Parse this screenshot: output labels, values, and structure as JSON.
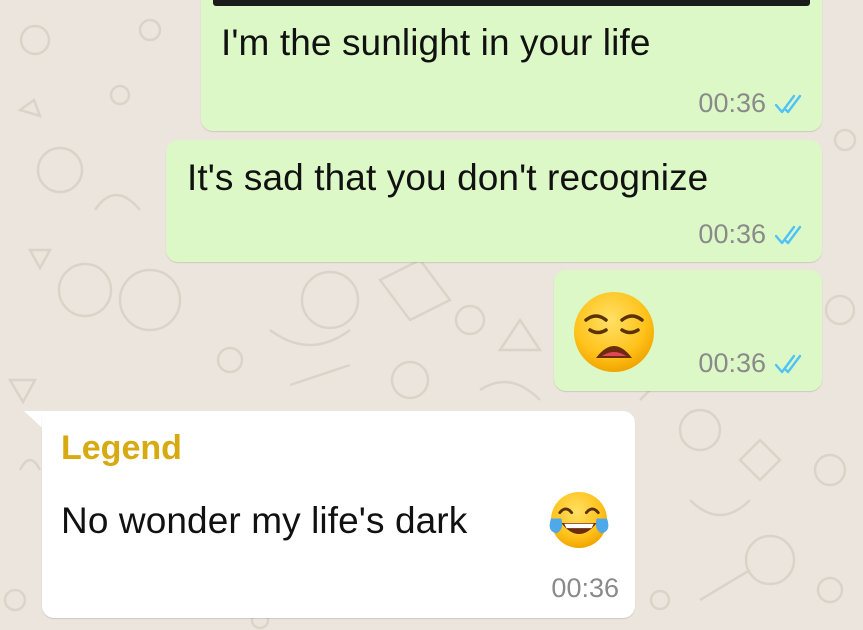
{
  "colors": {
    "outgoing_bubble": "#dcf8c6",
    "incoming_bubble": "#ffffff",
    "sender_name": "#d7aa12",
    "read_ticks": "#4fc3f7",
    "wallpaper": "#ece5dd"
  },
  "messages": [
    {
      "direction": "outgoing",
      "text": "I'm the sunlight in your life",
      "time": "00:36",
      "status": "read"
    },
    {
      "direction": "outgoing",
      "text": "It's sad that you don't recognize",
      "time": "00:36",
      "status": "read"
    },
    {
      "direction": "outgoing",
      "emoji": "weary-face-icon",
      "time": "00:36",
      "status": "read"
    },
    {
      "direction": "incoming",
      "sender": "Legend",
      "text": "No wonder my life's dark",
      "emoji": "tears-of-joy-icon",
      "time": "00:36"
    }
  ]
}
